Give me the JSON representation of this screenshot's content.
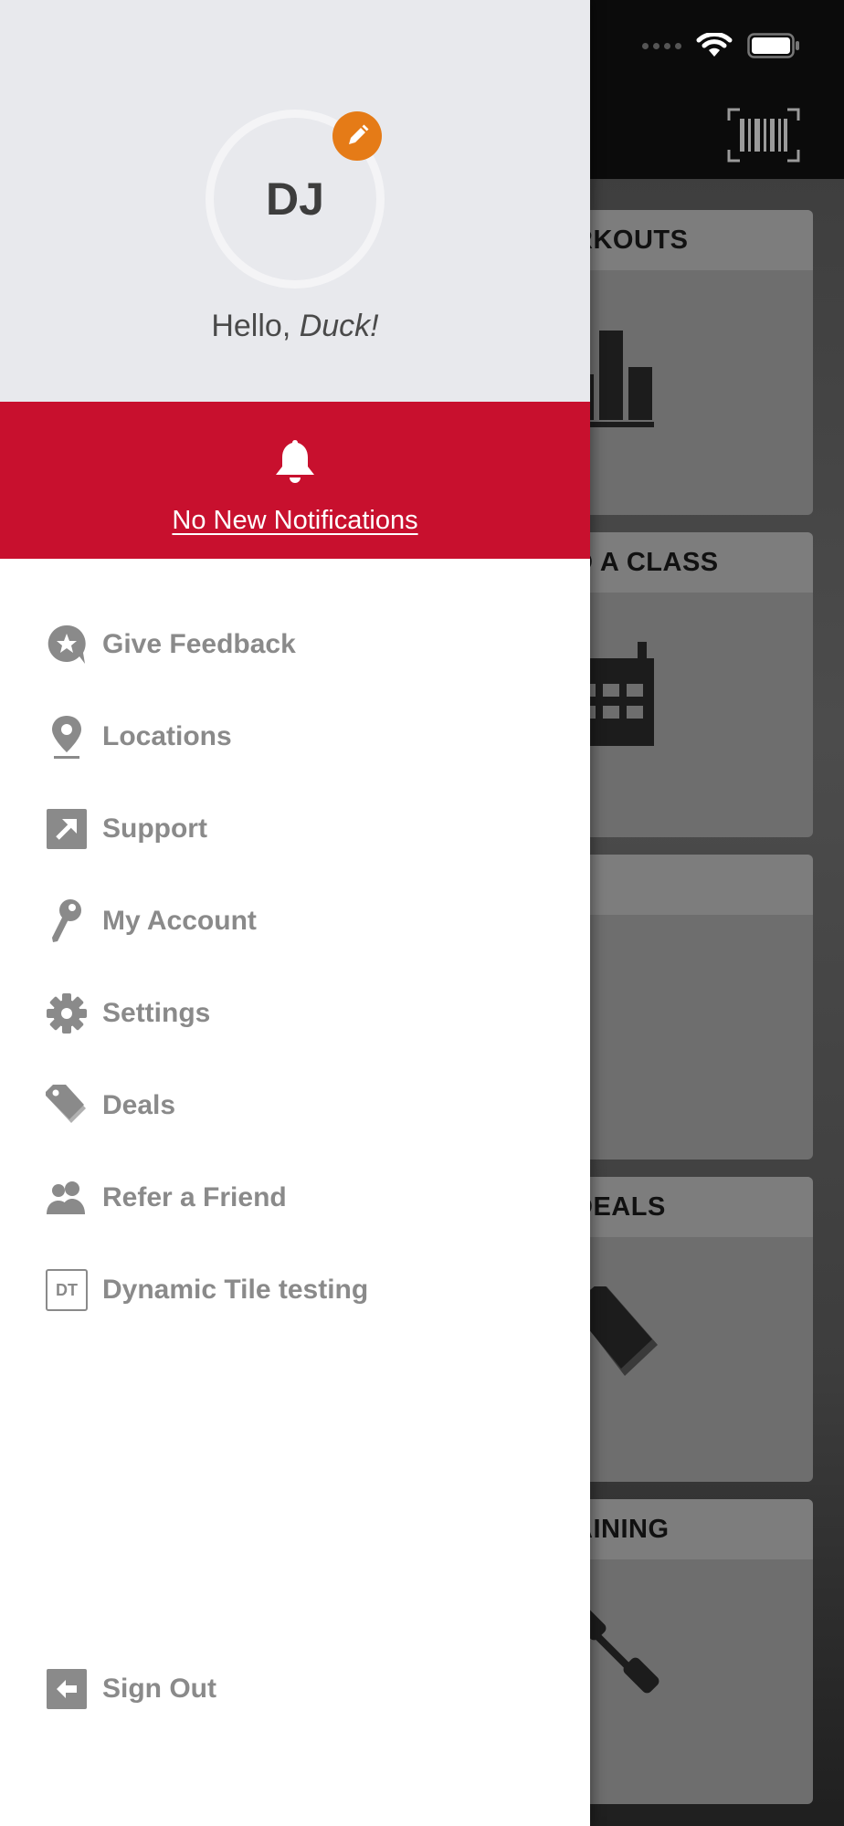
{
  "background_app": {
    "tiles": [
      {
        "label": "RKOUTS",
        "icon": "bar-chart-icon"
      },
      {
        "label": "D A CLASS",
        "icon": "calendar-icon"
      },
      {
        "label": "",
        "icon": ""
      },
      {
        "label": "DEALS",
        "icon": "tag-icon"
      },
      {
        "label": "AINING",
        "icon": "dumbbell-icon"
      }
    ],
    "topbar_icon": "barcode-icon"
  },
  "profile": {
    "initials": "DJ",
    "greeting_prefix": "Hello, ",
    "greeting_name": "Duck!",
    "edit_icon": "pencil-icon"
  },
  "notifications": {
    "text": "No New Notifications",
    "icon": "bell-icon",
    "color": "#c8102e"
  },
  "menu": {
    "items": [
      {
        "label": "Give Feedback",
        "icon": "feedback-star-icon"
      },
      {
        "label": "Locations",
        "icon": "location-pin-icon"
      },
      {
        "label": "Support",
        "icon": "external-link-icon"
      },
      {
        "label": "My Account",
        "icon": "key-icon"
      },
      {
        "label": "Settings",
        "icon": "gear-icon"
      },
      {
        "label": "Deals",
        "icon": "tag-icon"
      },
      {
        "label": "Refer a Friend",
        "icon": "people-icon"
      },
      {
        "label": "Dynamic Tile testing",
        "icon": "dt-badge-icon",
        "badge": "DT"
      }
    ],
    "sign_out": {
      "label": "Sign Out",
      "icon": "sign-out-icon"
    }
  },
  "colors": {
    "accent_orange": "#e57b17",
    "menu_text": "#8a8a8a",
    "profile_bg": "#e8e9ed"
  }
}
